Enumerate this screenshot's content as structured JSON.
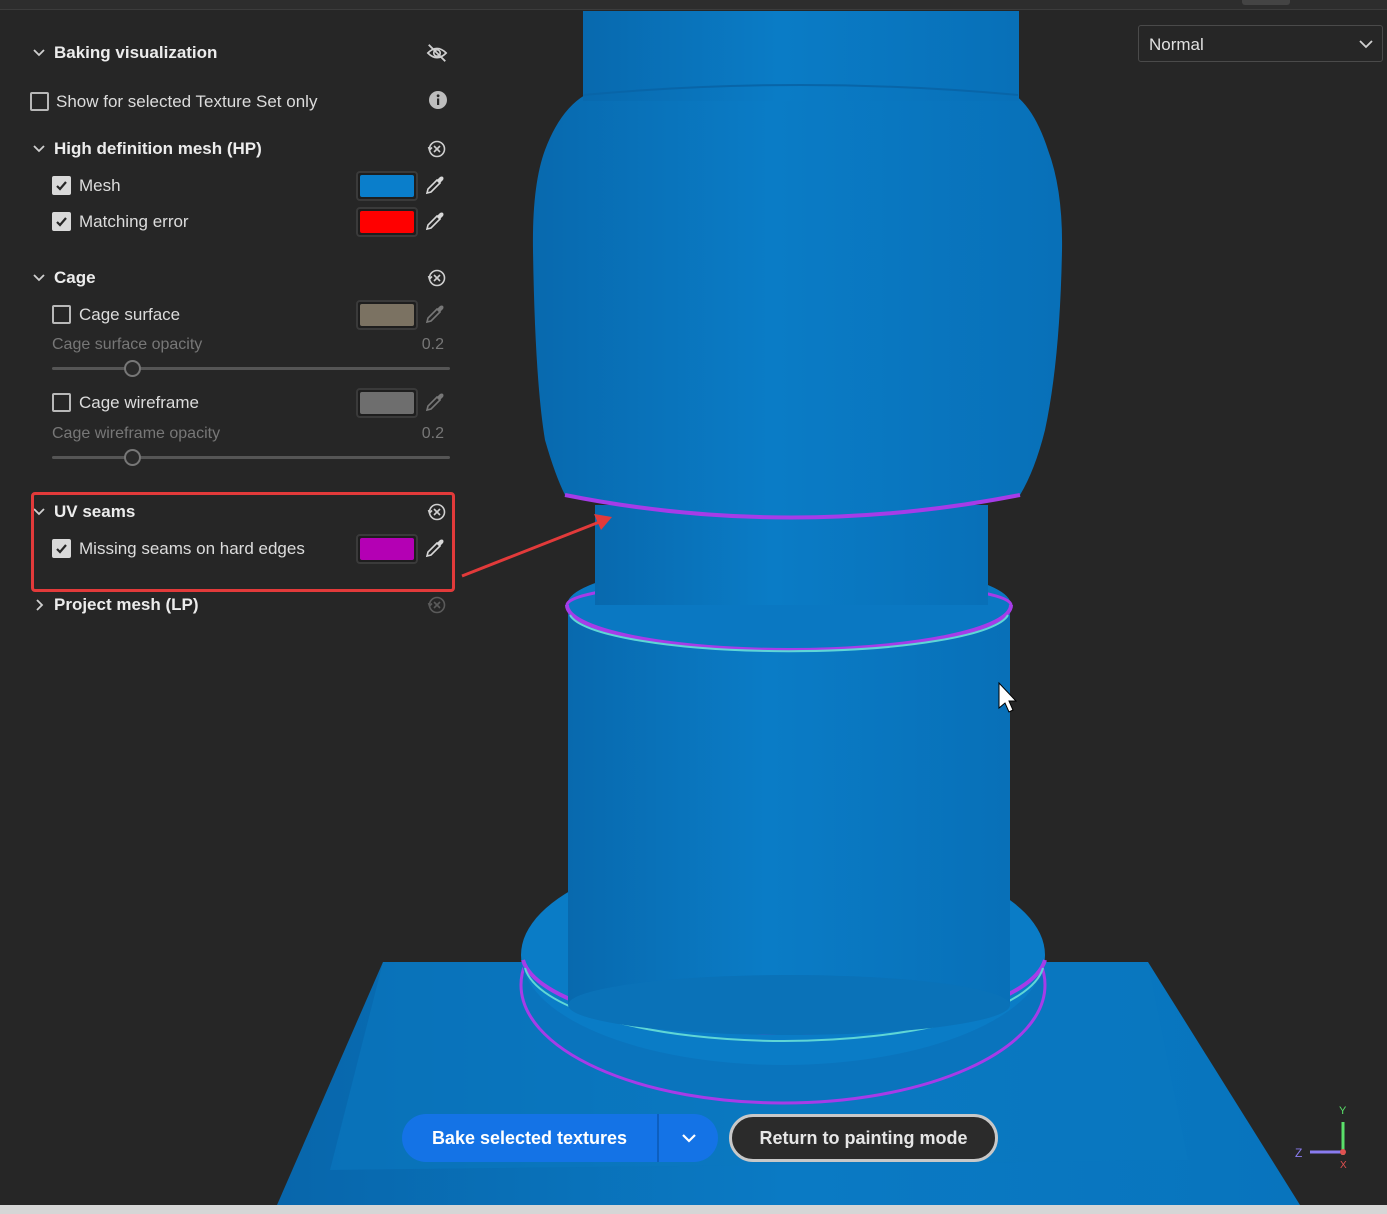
{
  "panel": {
    "baking_visualization": {
      "title": "Baking visualization",
      "expanded": true,
      "icon": "eye-off-icon"
    },
    "texture_set_only": {
      "label": "Show for selected Texture Set only",
      "checked": false,
      "icon": "info-icon"
    },
    "hp": {
      "title": "High definition mesh (HP)",
      "mesh": {
        "label": "Mesh",
        "checked": true,
        "color": "#0a7ecb"
      },
      "matching_error": {
        "label": "Matching error",
        "checked": true,
        "color": "#ff0000"
      }
    },
    "cage": {
      "title": "Cage",
      "surface": {
        "label": "Cage surface",
        "checked": false,
        "color": "#7b7262"
      },
      "surface_opacity": {
        "label": "Cage surface opacity",
        "value": "0.2",
        "fraction": 0.2
      },
      "wireframe": {
        "label": "Cage wireframe",
        "checked": false,
        "color": "#6e6e6e"
      },
      "wireframe_opacity": {
        "label": "Cage wireframe opacity",
        "value": "0.2",
        "fraction": 0.2
      }
    },
    "uv_seams": {
      "title": "UV seams",
      "missing_seams": {
        "label": "Missing seams on hard edges",
        "checked": true,
        "color": "#b400b4"
      }
    },
    "lp": {
      "title": "Project mesh (LP)",
      "expanded": false
    }
  },
  "viewport": {
    "mode": "Normal",
    "mesh_color": "#0a7bc4",
    "seam_color": "#a63ce8",
    "axis": {
      "y": "Y",
      "z": "Z",
      "x": "X"
    }
  },
  "actions": {
    "bake": "Bake selected textures",
    "return": "Return to painting mode"
  }
}
